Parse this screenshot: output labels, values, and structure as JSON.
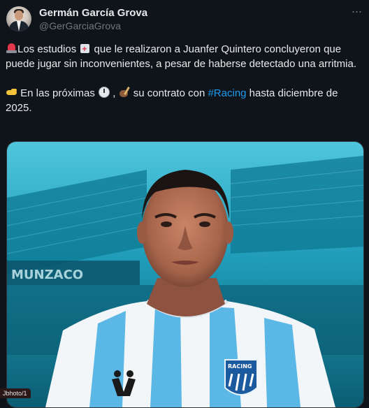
{
  "author": {
    "name": "Germán García Grova",
    "handle": "@GerGarciaGrova"
  },
  "tweet": {
    "line1_text": "Los estudios ",
    "line1_text2": " que le realizaron a Juanfer Quintero concluyeron que puede jugar sin inconvenientes, a pesar de haberse detectado una arritmia.",
    "line2_text": " En las próximas ",
    "line2_sep": " ,",
    "line2_text2": " su contrato con ",
    "hashtag": "#Racing",
    "line2_text3": " hasta diciembre de 2025.",
    "emojis": [
      "siren-emoji",
      "hospital-emoji",
      "pointing-hand-emoji",
      "clock-emoji",
      "writing-hand-emoji"
    ]
  },
  "media": {
    "description_colors": {
      "sky": "#1fa2c2",
      "stand": "#0e6d86",
      "jersey_blue": "#5bb8e6",
      "skin": "#b06f55"
    },
    "stadium_sign": "MUNZACO",
    "crest_text": "RACING",
    "overlay_badge": "Jbhoto/1"
  },
  "more_button": "···"
}
